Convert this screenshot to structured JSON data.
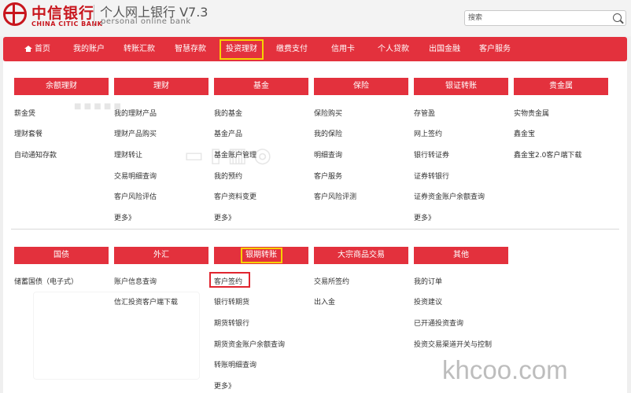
{
  "header": {
    "bank_name_cn": "中信银行",
    "bank_name_en": "CHINA CITIC BANK",
    "app_title": "个人网上银行 V7.3",
    "app_subtitle": "personal online bank"
  },
  "search": {
    "placeholder": "搜索"
  },
  "nav": {
    "items": [
      "首页",
      "我的账户",
      "转账汇款",
      "智慧存款",
      "投资理财",
      "缴费支付",
      "信用卡",
      "个人贷款",
      "出国金融",
      "客户服务"
    ],
    "active": "投资理财"
  },
  "row1": [
    {
      "title": "余额理财",
      "links": [
        "薪金煲",
        "理财套餐",
        "自动通知存款"
      ]
    },
    {
      "title": "理财",
      "links": [
        "我的理财产品",
        "理财产品购买",
        "理财转让",
        "交易明细查询",
        "客户风险评估",
        "更多》"
      ]
    },
    {
      "title": "基金",
      "links": [
        "我的基金",
        "基金产品",
        "基金账户管理",
        "我的预约",
        "客户资料变更",
        "更多》"
      ]
    },
    {
      "title": "保险",
      "links": [
        "保险购买",
        "我的保险",
        "明细查询",
        "客户服务",
        "客户风险评测"
      ]
    },
    {
      "title": "银证转账",
      "links": [
        "存管盈",
        "网上签约",
        "银行转证券",
        "证券转银行",
        "证券资金账户余额查询",
        "更多》"
      ]
    },
    {
      "title": "贵金属",
      "links": [
        "实物贵金属",
        "鑫金宝",
        "鑫金宝2.0客户端下载"
      ]
    }
  ],
  "row2": [
    {
      "title": "国债",
      "links": [
        "储蓄国债（电子式）"
      ]
    },
    {
      "title": "外汇",
      "links": [
        "账户信息查询",
        "信汇投资客户端下载"
      ]
    },
    {
      "title": "银期转账",
      "links": [
        "客户签约",
        "银行转期货",
        "期货转银行",
        "期货资金账户余额查询",
        "转账明细查询",
        "更多》"
      ]
    },
    {
      "title": "大宗商品交易",
      "links": [
        "交易所签约",
        "出入金"
      ]
    },
    {
      "title": "其他",
      "links": [
        "我的订单",
        "投资建议",
        "已开通投资查询",
        "投资交易渠道开关与控制"
      ]
    }
  ],
  "watermark": "khcoo.com",
  "colors": {
    "brand_red": "#e3313d",
    "logo_red": "#c8161d",
    "highlight_yellow": "#f5d200"
  }
}
